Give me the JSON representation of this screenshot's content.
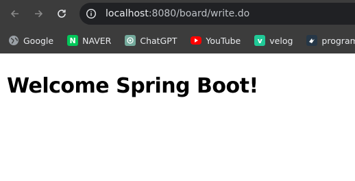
{
  "browser": {
    "url": {
      "host": "localhost",
      "rest": ":8080/board/write.do"
    },
    "bookmarks": [
      {
        "label": "Google",
        "icon": "globe-icon"
      },
      {
        "label": "NAVER",
        "icon": "naver-icon",
        "color": "#03c75a"
      },
      {
        "label": "ChatGPT",
        "icon": "chatgpt-icon",
        "color": "#74aa9c"
      },
      {
        "label": "YouTube",
        "icon": "youtube-icon",
        "color": "#ff0000"
      },
      {
        "label": "velog",
        "icon": "velog-icon",
        "color": "#20c997"
      },
      {
        "label": "programmers",
        "icon": "programmers-icon",
        "color": "#263747"
      }
    ]
  },
  "page": {
    "heading": "Welcome Spring Boot!"
  }
}
